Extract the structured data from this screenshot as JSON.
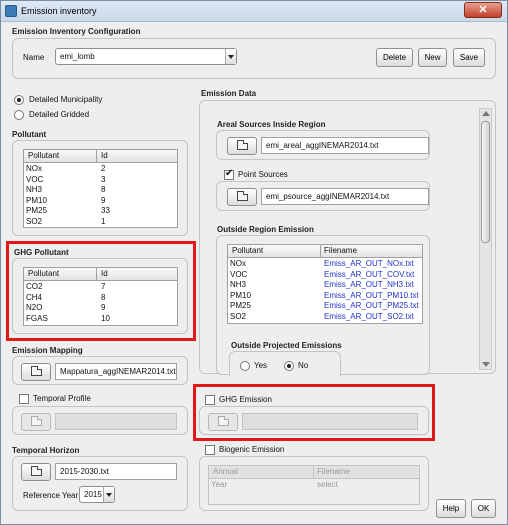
{
  "window": {
    "title": "Emission inventory",
    "close_label": "✕"
  },
  "config": {
    "title": "Emission Inventory Configuration",
    "name_label": "Name",
    "name_value": "emi_lomb",
    "delete_label": "Delete",
    "new_label": "New",
    "save_label": "Save"
  },
  "mode": {
    "municipality_label": "Detailed Municipality",
    "gridded_label": "Detailed Gridded",
    "selected": "municipality"
  },
  "pollutant": {
    "title": "Pollutant",
    "columns": [
      "Pollutant",
      "Id"
    ],
    "rows": [
      [
        "NOx",
        "2"
      ],
      [
        "VOC",
        "3"
      ],
      [
        "NH3",
        "8"
      ],
      [
        "PM10",
        "9"
      ],
      [
        "PM25",
        "33"
      ],
      [
        "SO2",
        "1"
      ]
    ]
  },
  "ghg_pollutant": {
    "title": "GHG Pollutant",
    "columns": [
      "Pollutant",
      "Id"
    ],
    "rows": [
      [
        "CO2",
        "7"
      ],
      [
        "CH4",
        "8"
      ],
      [
        "N2O",
        "9"
      ],
      [
        "FGAS",
        "10"
      ]
    ]
  },
  "emission_mapping": {
    "title": "Emission Mapping",
    "file": "Mappatura_aggINEMAR2014.txt"
  },
  "temporal_profile": {
    "label": "Temporal Profile",
    "checked": false,
    "file": ""
  },
  "temporal_horizon": {
    "title": "Temporal Horizon",
    "file": "2015-2030.txt",
    "ref_year_label": "Reference Year",
    "ref_year_value": "2015"
  },
  "emission_data": {
    "title": "Emission Data",
    "areal": {
      "title": "Areal Sources Inside Region",
      "file": "emi_areal_aggINEMAR2014.txt"
    },
    "point": {
      "label": "Point Sources",
      "checked": true,
      "file": "emi_psource_aggINEMAR2014.txt"
    },
    "outside": {
      "title": "Outside Region Emission",
      "columns": [
        "Pollutant",
        "Filename"
      ],
      "rows": [
        [
          "NOx",
          "Emiss_AR_OUT_NOx.txt"
        ],
        [
          "VOC",
          "Emiss_AR_OUT_COV.txt"
        ],
        [
          "NH3",
          "Emiss_AR_OUT_NH3.txt"
        ],
        [
          "PM10",
          "Emiss_AR_OUT_PM10.txt"
        ],
        [
          "PM25",
          "Emiss_AR_OUT_PM25.txt"
        ],
        [
          "SO2",
          "Emiss_AR_OUT_SO2.txt"
        ]
      ],
      "projected_title": "Outside Projected Emissions",
      "yes_label": "Yes",
      "no_label": "No",
      "projected_selected": "No"
    }
  },
  "ghg_emission": {
    "label": "GHG Emission",
    "checked": false,
    "file": ""
  },
  "biogenic": {
    "label": "Biogenic Emission",
    "checked": false,
    "columns": [
      "Annual",
      "Filename"
    ],
    "rows": [
      [
        "Year",
        "select"
      ]
    ]
  },
  "footer": {
    "help_label": "Help",
    "ok_label": "OK"
  }
}
